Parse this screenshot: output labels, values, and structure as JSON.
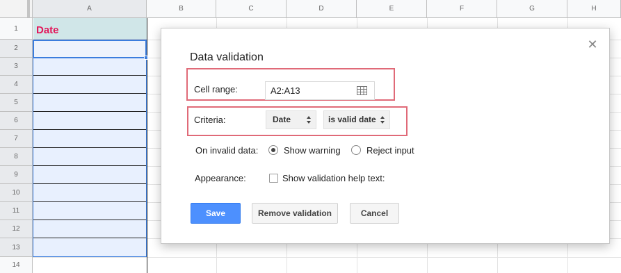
{
  "sheet": {
    "columns": [
      "A",
      "B",
      "C",
      "D",
      "E",
      "F",
      "G",
      "H"
    ],
    "rows": [
      "1",
      "2",
      "3",
      "4",
      "5",
      "6",
      "7",
      "8",
      "9",
      "10",
      "11",
      "12",
      "13",
      "14"
    ],
    "cell_a1": "Date"
  },
  "dialog": {
    "title": "Data validation",
    "close_icon": "close-icon",
    "cell_range_label": "Cell range:",
    "cell_range_value": "A2:A13",
    "criteria_label": "Criteria:",
    "criteria_type": "Date",
    "criteria_condition": "is valid date",
    "invalid_label": "On invalid data:",
    "show_warning": "Show warning",
    "reject_input": "Reject input",
    "appearance_label": "Appearance:",
    "show_help_text": "Show validation help text:",
    "save": "Save",
    "remove": "Remove validation",
    "cancel": "Cancel"
  },
  "colors": {
    "accent": "#4d90fe",
    "highlight": "#e06a78",
    "header_text": "#e2175a"
  }
}
